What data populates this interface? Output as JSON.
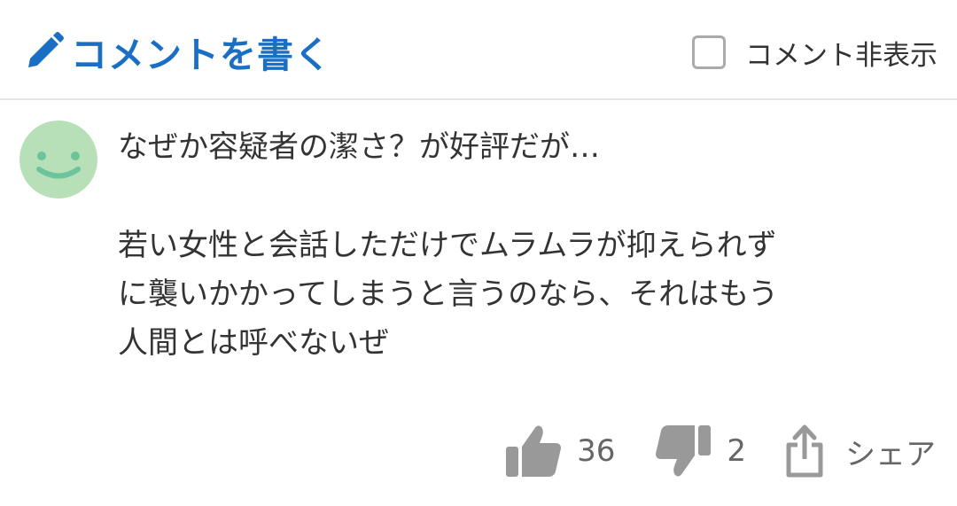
{
  "header": {
    "write_comment_label": "コメントを書く",
    "hide_comments_label": "コメント非表示",
    "hide_comments_checked": false,
    "accent_color": "#1a6fc4"
  },
  "comment": {
    "avatar_icon": "smiley-face-icon",
    "avatar_color": "#b8e0b8",
    "lines": [
      "なぜか容疑者の潔さ？が好評だが…",
      "若い女性と会話しただけでムラムラが抑えられず",
      "に襲いかかってしまうと言うのなら、それはもう",
      "人間とは呼べないぜ"
    ]
  },
  "actions": {
    "like_count": "36",
    "dislike_count": "2",
    "share_label": "シェア",
    "icon_color": "#999999"
  }
}
